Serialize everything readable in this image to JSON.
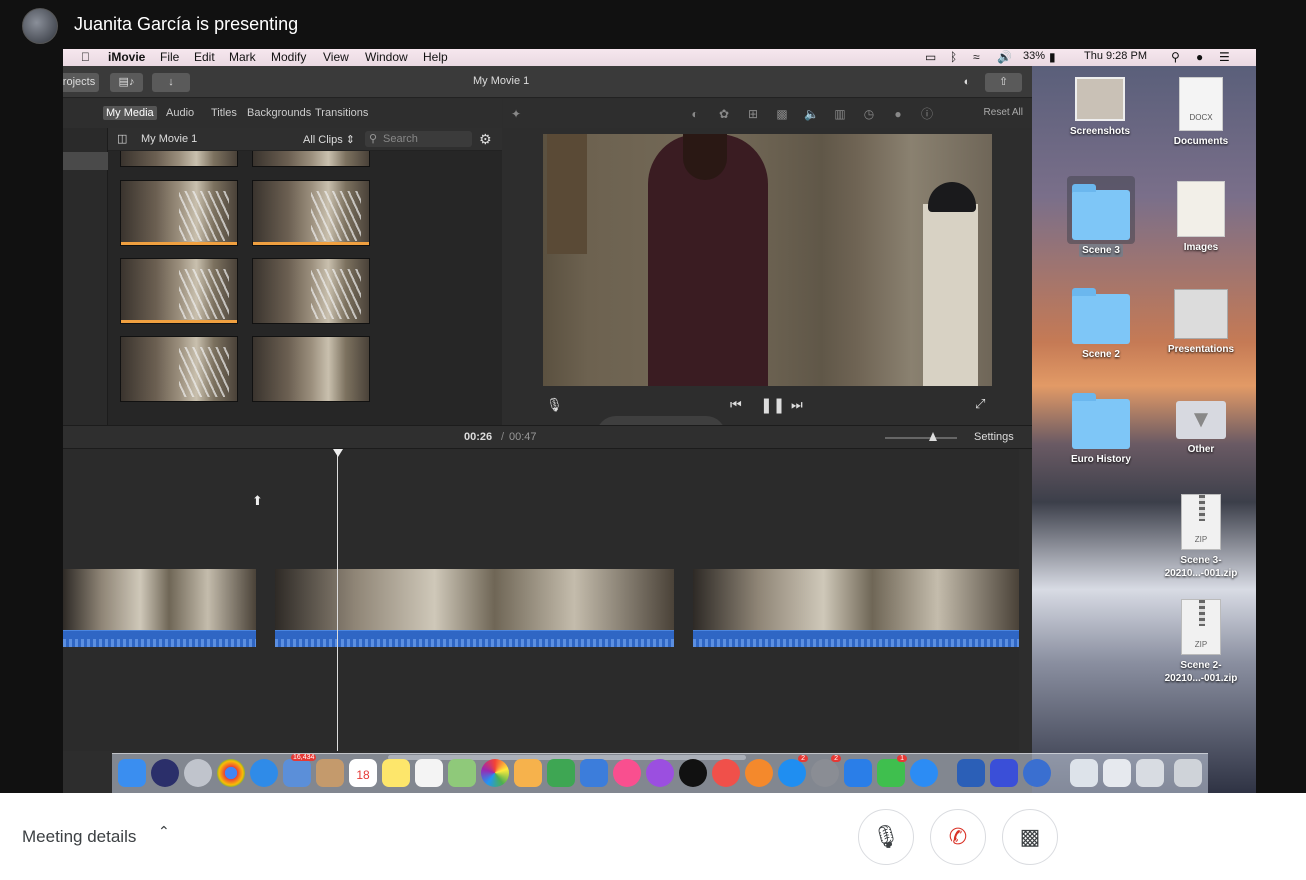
{
  "meet": {
    "presenter_text": "Juanita García is presenting",
    "meeting_details_label": "Meeting details"
  },
  "menubar": {
    "app": "iMovie",
    "items": [
      "File",
      "Edit",
      "Mark",
      "Modify",
      "View",
      "Window",
      "Help"
    ],
    "battery": "33%",
    "clock": "Thu 9:28 PM"
  },
  "imovie": {
    "projects_btn": "rojects",
    "window_title": "My Movie 1",
    "media_tabs": [
      "My Media",
      "Audio",
      "Titles",
      "Backgrounds",
      "Transitions"
    ],
    "library_name": "My Movie 1",
    "clips_filter": "All Clips",
    "search_placeholder": "Search",
    "reset_all": "Reset All",
    "time_current": "00:26",
    "time_sep": "/",
    "time_total": "00:47",
    "settings_label": "Settings"
  },
  "desktop": {
    "icons": [
      {
        "label": "Screenshots"
      },
      {
        "label": "Documents",
        "badge": "DOCX"
      },
      {
        "label": "Scene 3"
      },
      {
        "label": "Images"
      },
      {
        "label": "Scene 2"
      },
      {
        "label": "Presentations"
      },
      {
        "label": "Euro History"
      },
      {
        "label": "Other"
      },
      {
        "label": "Scene 3-20210...-001.zip",
        "badge": "ZIP"
      },
      {
        "label": "Scene 2-20210...-001.zip",
        "badge": "ZIP"
      }
    ]
  },
  "dock": {
    "badges": {
      "photos": "16,434",
      "calendar_day": "18",
      "appstore": "2",
      "settings": "2",
      "facetime": "1"
    }
  },
  "colors": {
    "meet_bg": "#111111",
    "imovie_bg": "#2d2d2d",
    "audio_track": "#2f66c4",
    "folder": "#7ec6f7",
    "end_call": "#d93025"
  }
}
